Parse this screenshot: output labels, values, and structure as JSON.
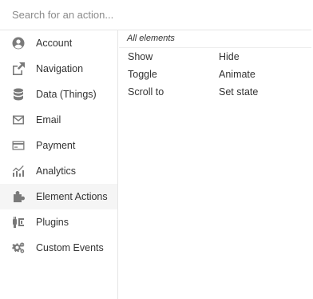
{
  "search": {
    "placeholder": "Search for an action..."
  },
  "sidebar": {
    "items": [
      {
        "label": "Account",
        "icon": "user-circle-icon"
      },
      {
        "label": "Navigation",
        "icon": "share-arrow-icon"
      },
      {
        "label": "Data (Things)",
        "icon": "database-icon"
      },
      {
        "label": "Email",
        "icon": "envelope-icon"
      },
      {
        "label": "Payment",
        "icon": "credit-card-icon"
      },
      {
        "label": "Analytics",
        "icon": "line-chart-icon"
      },
      {
        "label": "Element Actions",
        "icon": "puzzle-piece-icon"
      },
      {
        "label": "Plugins",
        "icon": "plug-icon"
      },
      {
        "label": "Custom Events",
        "icon": "gears-icon"
      }
    ],
    "active_item": "Element Actions"
  },
  "content": {
    "section_title": "All elements",
    "actions": [
      {
        "label": "Show"
      },
      {
        "label": "Hide"
      },
      {
        "label": "Toggle"
      },
      {
        "label": "Animate"
      },
      {
        "label": "Scroll to"
      },
      {
        "label": "Set state"
      }
    ]
  },
  "colors": {
    "icon": "#7a7a7a",
    "active_background": "#f5f5f5",
    "divider": "#e6e6e6",
    "text": "#333333",
    "placeholder": "#8b8b8b"
  }
}
